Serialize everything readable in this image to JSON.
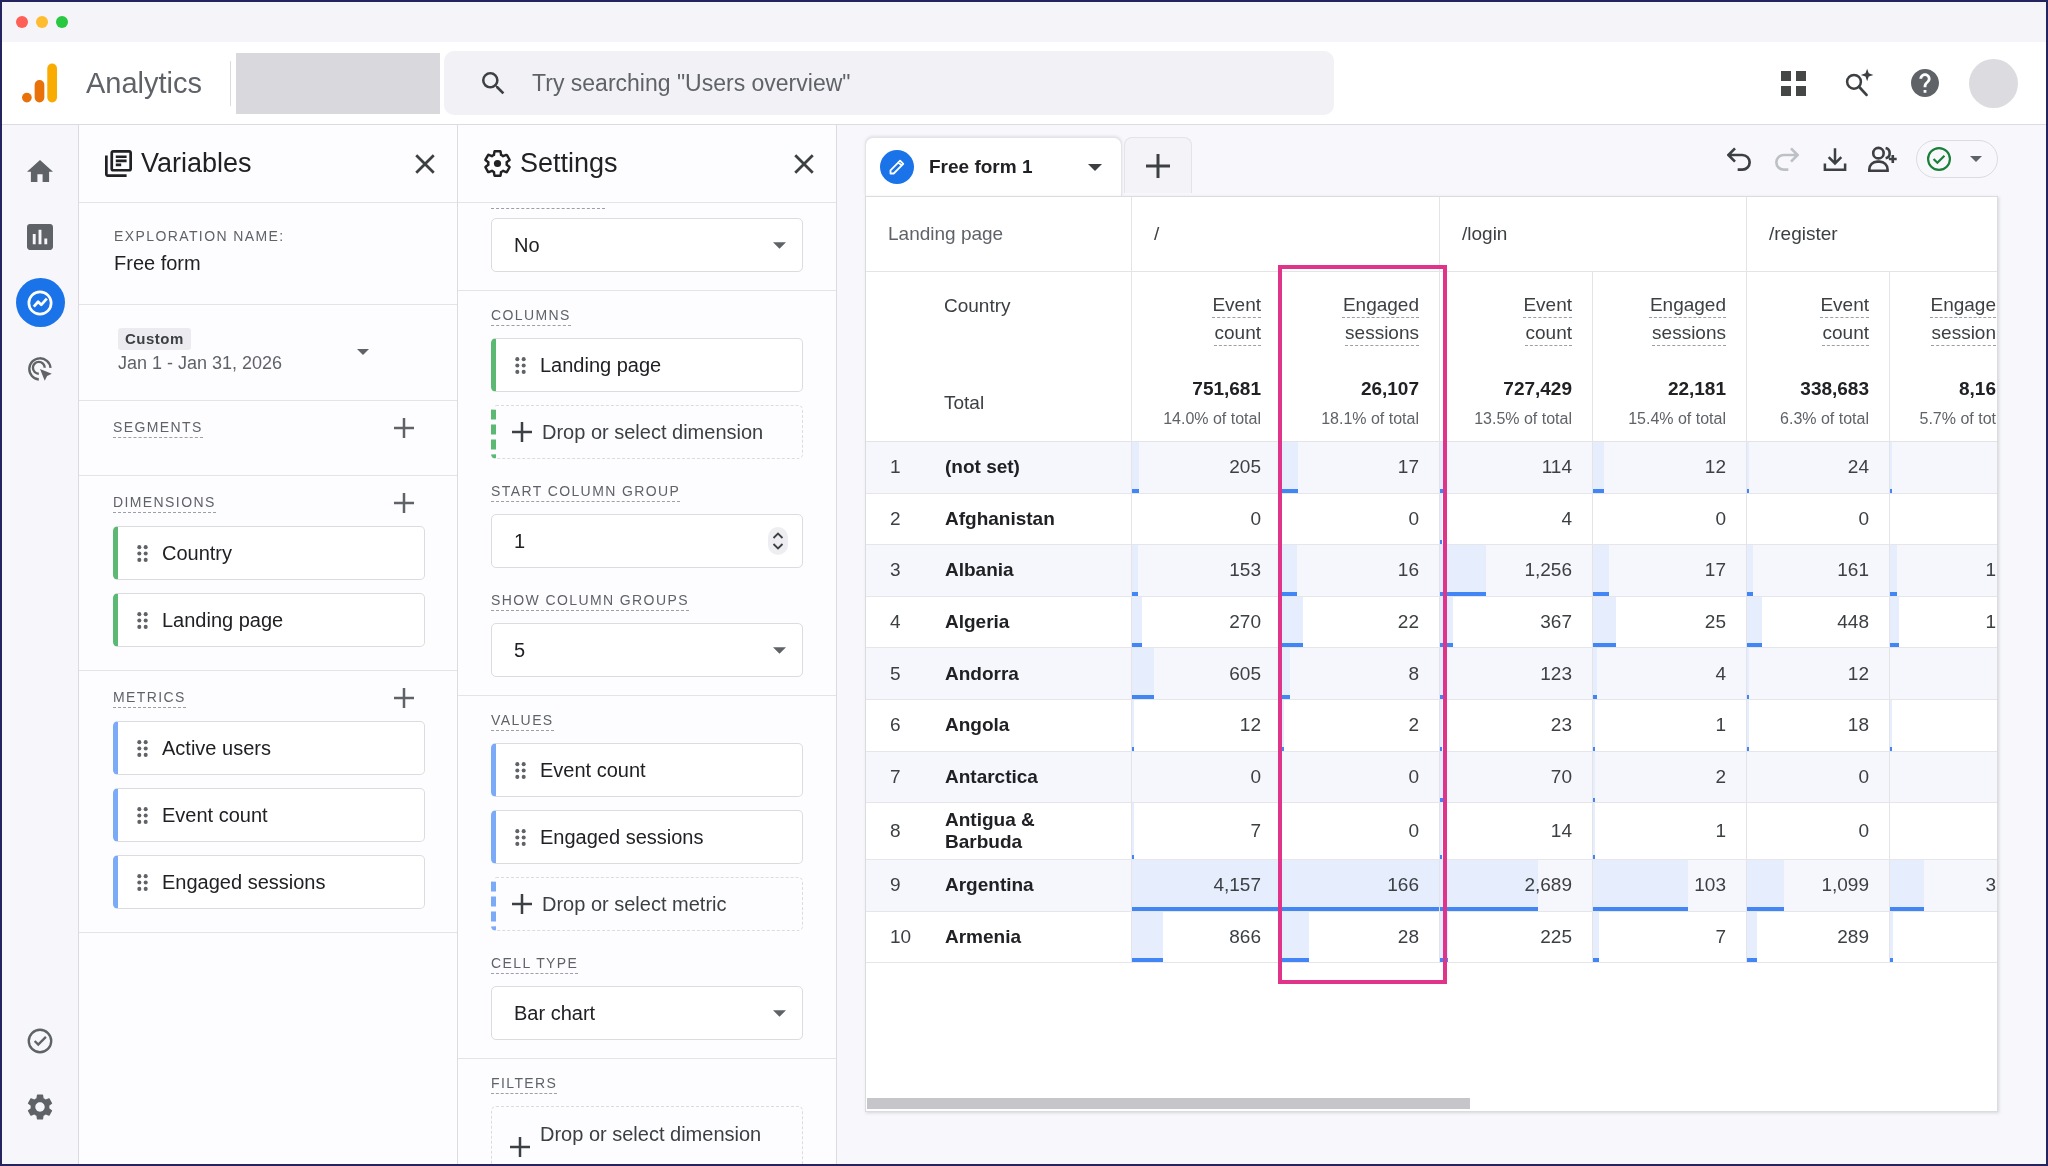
{
  "header": {
    "app_name": "Analytics",
    "search": {
      "placeholder": "Try searching \"Users overview\""
    }
  },
  "nav_rail": [
    {
      "selected": false
    },
    {
      "selected": false
    },
    {
      "selected": true
    },
    {
      "selected": false
    }
  ],
  "variables_panel": {
    "title": "Variables",
    "exploration_name": {
      "label": "EXPLORATION NAME:",
      "value": "Free form"
    },
    "date_range": {
      "preset": "Custom",
      "range": "Jan 1 - Jan 31, 2026"
    },
    "sections": [
      {
        "label": "SEGMENTS"
      },
      {
        "label": "DIMENSIONS",
        "kind": "dimension",
        "items": [
          "Country",
          "Landing page"
        ]
      },
      {
        "label": "METRICS",
        "kind": "metric",
        "items": [
          "Active users",
          "Event count",
          "Engaged sessions"
        ]
      }
    ]
  },
  "settings_panel": {
    "title": "Settings",
    "groups": [
      {
        "fields": [
          {
            "kind": "dropdown",
            "value": "No"
          }
        ]
      },
      {
        "fields": [
          {
            "kind": "label",
            "text": "COLUMNS"
          },
          {
            "kind": "dimension",
            "text": "Landing page"
          },
          {
            "kind": "add_dimension",
            "text": "Drop or select dimension"
          },
          {
            "kind": "label",
            "text": "START COLUMN GROUP"
          },
          {
            "kind": "number",
            "value": "1"
          },
          {
            "kind": "label",
            "text": "SHOW COLUMN GROUPS"
          },
          {
            "kind": "dropdown",
            "value": "5"
          }
        ]
      },
      {
        "fields": [
          {
            "kind": "label",
            "text": "VALUES"
          },
          {
            "kind": "metric",
            "text": "Event count"
          },
          {
            "kind": "metric",
            "text": "Engaged sessions"
          },
          {
            "kind": "add_metric",
            "text": "Drop or select metric"
          },
          {
            "kind": "label",
            "text": "CELL TYPE"
          },
          {
            "kind": "dropdown",
            "value": "Bar chart"
          }
        ]
      },
      {
        "fields": [
          {
            "kind": "label",
            "text": "FILTERS"
          },
          {
            "kind": "add_filter",
            "text": "Drop or select dimension"
          }
        ]
      }
    ]
  },
  "tabs": [
    {
      "label": "Free form 1",
      "selected": true
    }
  ],
  "toolbar": [
    {
      "disabled": false
    },
    {
      "disabled": true
    },
    {
      "disabled": false
    },
    {
      "disabled": false
    }
  ],
  "table": {
    "column_dimension": "Landing page",
    "row_dimension": "Country",
    "total_label": "Total",
    "column_groups": [
      {
        "label": "/",
        "metrics": [
          {
            "label": "Event count",
            "total": "751,681",
            "share": "14.0% of total"
          },
          {
            "label": "Engaged sessions",
            "total": "26,107",
            "share": "18.1% of total",
            "highlighted": true
          }
        ]
      },
      {
        "label": "/login",
        "metrics": [
          {
            "label": "Event count",
            "total": "727,429",
            "share": "13.5% of total"
          },
          {
            "label": "Engaged sessions",
            "total": "22,181",
            "share": "15.4% of total"
          }
        ]
      },
      {
        "label": "/register",
        "metrics": [
          {
            "label": "Event count",
            "total": "338,683",
            "share": "6.3% of total"
          },
          {
            "label": "Engage session",
            "total": "8,16",
            "share": "5.7% of tot"
          }
        ]
      }
    ],
    "rows": [
      {
        "number": "1",
        "label": "(not set)",
        "cells": [
          {
            "value": "205",
            "level": 0.049
          },
          {
            "value": "17",
            "level": 0.102
          },
          {
            "value": "114",
            "level": 0.027
          },
          {
            "value": "12",
            "level": 0.072
          },
          {
            "value": "24",
            "level": 0.006
          },
          {
            "level": 0.012
          }
        ]
      },
      {
        "number": "2",
        "label": "Afghanistan",
        "cells": [
          {
            "value": "0"
          },
          {
            "value": "0"
          },
          {
            "value": "4",
            "level": 0.001
          },
          {
            "value": "0"
          },
          {
            "value": "0"
          },
          null
        ]
      },
      {
        "number": "3",
        "label": "Albania",
        "cells": [
          {
            "value": "153",
            "level": 0.037
          },
          {
            "value": "16",
            "level": 0.096
          },
          {
            "value": "1,256",
            "level": 0.302
          },
          {
            "value": "17",
            "level": 0.102
          },
          {
            "value": "161",
            "level": 0.039
          },
          {
            "value": "1",
            "level": 0.07
          }
        ]
      },
      {
        "number": "4",
        "label": "Algeria",
        "cells": [
          {
            "value": "270",
            "level": 0.065
          },
          {
            "value": "22",
            "level": 0.133
          },
          {
            "value": "367",
            "level": 0.088
          },
          {
            "value": "25",
            "level": 0.151
          },
          {
            "value": "448",
            "level": 0.108
          },
          {
            "value": "1",
            "level": 0.08
          }
        ]
      },
      {
        "number": "5",
        "label": "Andorra",
        "cells": [
          {
            "value": "605",
            "level": 0.146
          },
          {
            "value": "8",
            "level": 0.048
          },
          {
            "value": "123",
            "level": 0.03
          },
          {
            "value": "4",
            "level": 0.024
          },
          {
            "value": "12",
            "level": 0.003
          },
          null
        ]
      },
      {
        "number": "6",
        "label": "Angola",
        "cells": [
          {
            "value": "12",
            "level": 0.003
          },
          {
            "value": "2",
            "level": 0.012
          },
          {
            "value": "23",
            "level": 0.006
          },
          {
            "value": "1",
            "level": 0.006
          },
          {
            "value": "18",
            "level": 0.004
          },
          {
            "level": 0.01
          }
        ]
      },
      {
        "number": "7",
        "label": "Antarctica",
        "cells": [
          {
            "value": "0"
          },
          {
            "value": "0"
          },
          {
            "value": "70",
            "level": 0.017
          },
          {
            "value": "2",
            "level": 0.012
          },
          {
            "value": "0"
          },
          null
        ]
      },
      {
        "number": "8",
        "label": "Antigua & Barbuda",
        "cells": [
          {
            "value": "7",
            "level": 0.002
          },
          {
            "value": "0"
          },
          {
            "value": "14",
            "level": 0.003
          },
          {
            "value": "1",
            "level": 0.006
          },
          {
            "value": "0"
          },
          null
        ]
      },
      {
        "number": "9",
        "label": "Argentina",
        "cells": [
          {
            "value": "4,157",
            "level": 1
          },
          {
            "value": "166",
            "level": 1
          },
          {
            "value": "2,689",
            "level": 0.647
          },
          {
            "value": "103",
            "level": 0.62
          },
          {
            "value": "1,099",
            "level": 0.264
          },
          {
            "value": "3",
            "level": 0.32
          }
        ]
      },
      {
        "number": "10",
        "label": "Armenia",
        "cells": [
          {
            "value": "866",
            "level": 0.208
          },
          {
            "value": "28",
            "level": 0.169
          },
          {
            "value": "225",
            "level": 0.054
          },
          {
            "value": "7",
            "level": 0.042
          },
          {
            "value": "289",
            "level": 0.07
          },
          {
            "level": 0.03
          }
        ]
      }
    ]
  }
}
